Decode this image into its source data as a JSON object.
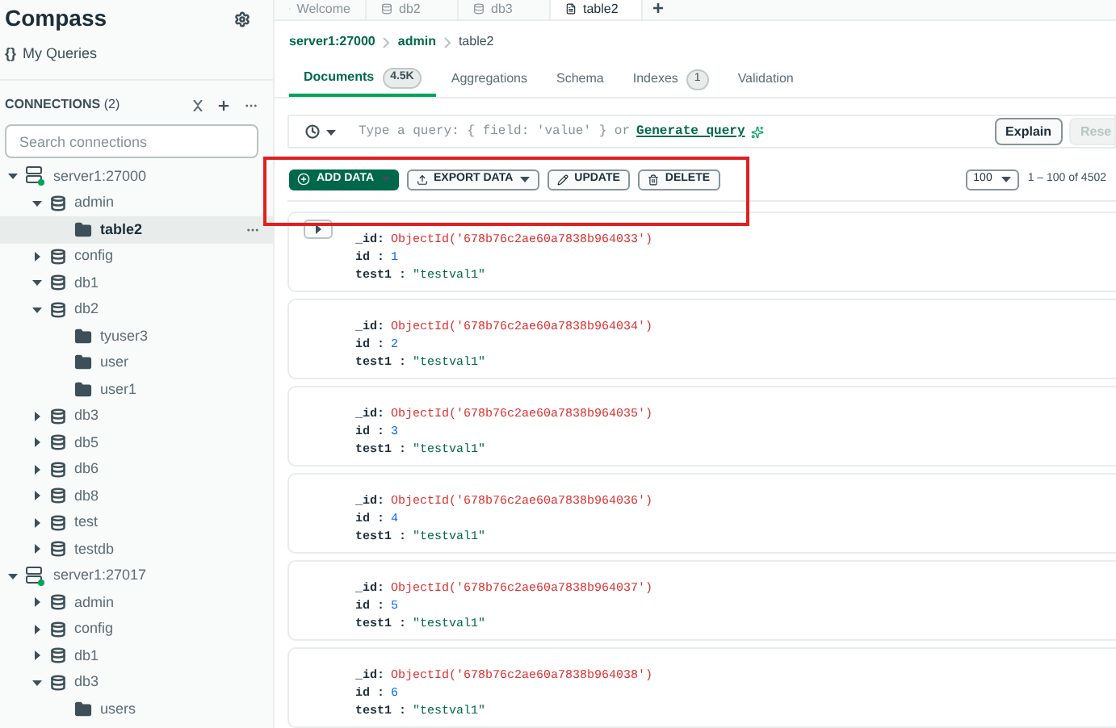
{
  "sidebar": {
    "title": "Compass",
    "my_queries": {
      "icon_text": "{}",
      "label": "My Queries"
    },
    "connections_label": "CONNECTIONS",
    "connections_count": "(2)",
    "search": {
      "placeholder": "Search connections"
    },
    "tree": [
      {
        "kind": "server",
        "label": "server1:27000",
        "expanded": true,
        "selected": false,
        "children": [
          {
            "kind": "database",
            "label": "admin",
            "expanded": true,
            "selected": false,
            "children": [
              {
                "kind": "collection",
                "label": "table2",
                "selected": true
              }
            ]
          },
          {
            "kind": "database",
            "label": "config",
            "expanded": false,
            "selected": false
          },
          {
            "kind": "database",
            "label": "db1",
            "expanded": true,
            "selected": false
          },
          {
            "kind": "database",
            "label": "db2",
            "expanded": true,
            "selected": false,
            "children": [
              {
                "kind": "collection",
                "label": "tyuser3",
                "selected": false
              },
              {
                "kind": "collection",
                "label": "user",
                "selected": false
              },
              {
                "kind": "collection",
                "label": "user1",
                "selected": false
              }
            ]
          },
          {
            "kind": "database",
            "label": "db3",
            "expanded": false,
            "selected": false
          },
          {
            "kind": "database",
            "label": "db5",
            "expanded": false,
            "selected": false
          },
          {
            "kind": "database",
            "label": "db6",
            "expanded": false,
            "selected": false
          },
          {
            "kind": "database",
            "label": "db8",
            "expanded": false,
            "selected": false
          },
          {
            "kind": "database",
            "label": "test",
            "expanded": false,
            "selected": false
          },
          {
            "kind": "database",
            "label": "testdb",
            "expanded": false,
            "selected": false
          }
        ]
      },
      {
        "kind": "server",
        "label": "server1:27017",
        "expanded": true,
        "selected": false,
        "children": [
          {
            "kind": "database",
            "label": "admin",
            "expanded": false,
            "selected": false
          },
          {
            "kind": "database",
            "label": "config",
            "expanded": false,
            "selected": false
          },
          {
            "kind": "database",
            "label": "db1",
            "expanded": false,
            "selected": false
          },
          {
            "kind": "database",
            "label": "db3",
            "expanded": true,
            "selected": false,
            "children": [
              {
                "kind": "collection",
                "label": "users",
                "selected": false
              }
            ]
          }
        ]
      }
    ]
  },
  "workspace_tabs": [
    {
      "kind": "welcome",
      "label": "Welcome",
      "selected": false
    },
    {
      "kind": "database",
      "label": "db2",
      "selected": false
    },
    {
      "kind": "database",
      "label": "db3",
      "selected": false
    },
    {
      "kind": "collection",
      "label": "table2",
      "selected": true
    }
  ],
  "new_tab": "+",
  "breadcrumb": [
    {
      "label": "server1:27000"
    },
    {
      "label": "admin"
    },
    {
      "label": "table2"
    }
  ],
  "nav_tabs": [
    {
      "label": "Documents",
      "badge": "4.5K",
      "selected": true
    },
    {
      "label": "Aggregations",
      "selected": false
    },
    {
      "label": "Schema",
      "selected": false
    },
    {
      "label": "Indexes",
      "badge": "1",
      "selected": false
    },
    {
      "label": "Validation",
      "selected": false
    }
  ],
  "query": {
    "placeholder": "Type a query: { field: 'value' } or",
    "generate_link": "Generate query",
    "explain": "Explain",
    "reset": "Rese"
  },
  "toolbar": {
    "add_data": "ADD DATA",
    "export_data": "EXPORT DATA",
    "update": "UPDATE",
    "delete": "DELETE",
    "page_size": "100",
    "range": "1 – 100 of 4502"
  },
  "documents": [
    {
      "expand_button": true,
      "fields": [
        {
          "key": "_id:",
          "value": "ObjectId('678b76c2ae60a7838b964033')",
          "kind": "objectid"
        },
        {
          "key": "id :",
          "value": "1",
          "kind": "number"
        },
        {
          "key": "test1 :",
          "value": "\"testval1\"",
          "kind": "string"
        }
      ]
    },
    {
      "expand_button": false,
      "fields": [
        {
          "key": "_id:",
          "value": "ObjectId('678b76c2ae60a7838b964034')",
          "kind": "objectid"
        },
        {
          "key": "id :",
          "value": "2",
          "kind": "number"
        },
        {
          "key": "test1 :",
          "value": "\"testval1\"",
          "kind": "string"
        }
      ]
    },
    {
      "expand_button": false,
      "fields": [
        {
          "key": "_id:",
          "value": "ObjectId('678b76c2ae60a7838b964035')",
          "kind": "objectid"
        },
        {
          "key": "id :",
          "value": "3",
          "kind": "number"
        },
        {
          "key": "test1 :",
          "value": "\"testval1\"",
          "kind": "string"
        }
      ]
    },
    {
      "expand_button": false,
      "fields": [
        {
          "key": "_id:",
          "value": "ObjectId('678b76c2ae60a7838b964036')",
          "kind": "objectid"
        },
        {
          "key": "id :",
          "value": "4",
          "kind": "number"
        },
        {
          "key": "test1 :",
          "value": "\"testval1\"",
          "kind": "string"
        }
      ]
    },
    {
      "expand_button": false,
      "fields": [
        {
          "key": "_id:",
          "value": "ObjectId('678b76c2ae60a7838b964037')",
          "kind": "objectid"
        },
        {
          "key": "id :",
          "value": "5",
          "kind": "number"
        },
        {
          "key": "test1 :",
          "value": "\"testval1\"",
          "kind": "string"
        }
      ]
    },
    {
      "expand_button": false,
      "fields": [
        {
          "key": "_id:",
          "value": "ObjectId('678b76c2ae60a7838b964038')",
          "kind": "objectid"
        },
        {
          "key": "id :",
          "value": "6",
          "kind": "number"
        },
        {
          "key": "test1 :",
          "value": "\"testval1\"",
          "kind": "string"
        }
      ]
    }
  ]
}
